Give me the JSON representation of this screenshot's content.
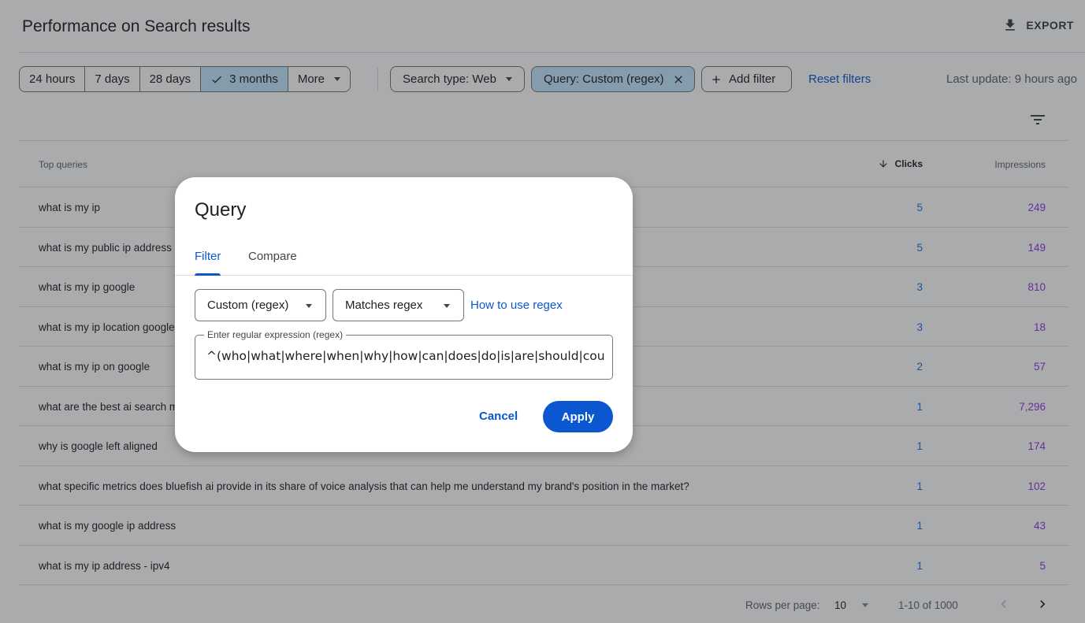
{
  "header": {
    "title": "Performance on Search results",
    "export_label": "EXPORT"
  },
  "date_range": {
    "options": [
      "24 hours",
      "7 days",
      "28 days",
      "3 months",
      "More"
    ],
    "selected": "3 months"
  },
  "filters": {
    "search_type": "Search type: Web",
    "query_chip": "Query: Custom (regex)",
    "add_filter": "Add filter",
    "reset": "Reset filters",
    "last_update": "Last update: 9 hours ago"
  },
  "table": {
    "col_query": "Top queries",
    "col_clicks": "Clicks",
    "col_impressions": "Impressions",
    "rows": [
      {
        "query": "what is my ip",
        "clicks": "5",
        "impressions": "249"
      },
      {
        "query": "what is my public ip address",
        "clicks": "5",
        "impressions": "149"
      },
      {
        "query": "what is my ip google",
        "clicks": "3",
        "impressions": "810"
      },
      {
        "query": "what is my ip location google",
        "clicks": "3",
        "impressions": "18"
      },
      {
        "query": "what is my ip on google",
        "clicks": "2",
        "impressions": "57"
      },
      {
        "query": "what are the best ai search m",
        "clicks": "1",
        "impressions": "7,296"
      },
      {
        "query": "why is google left aligned",
        "clicks": "1",
        "impressions": "174"
      },
      {
        "query": "what specific metrics does bluefish ai provide in its share of voice analysis that can help me understand my brand's position in the market?",
        "clicks": "1",
        "impressions": "102"
      },
      {
        "query": "what is my google ip address",
        "clicks": "1",
        "impressions": "43"
      },
      {
        "query": "what is my ip address - ipv4",
        "clicks": "1",
        "impressions": "5"
      }
    ]
  },
  "pagination": {
    "rows_per_page_label": "Rows per page:",
    "rows_per_page_value": "10",
    "range": "1-10 of 1000"
  },
  "dialog": {
    "title": "Query",
    "tabs": [
      "Filter",
      "Compare"
    ],
    "active_tab": "Filter",
    "type_select": "Custom (regex)",
    "match_select": "Matches regex",
    "help_link": "How to use regex",
    "field_label": "Enter regular expression (regex)",
    "field_value": "^(who|what|where|when|why|how|can|does|do|is|are|should|could",
    "cancel": "Cancel",
    "apply": "Apply"
  },
  "colors": {
    "accent": "#0b57d0",
    "selected_chip": "#c2e7ff",
    "clicks": "#1a73e8",
    "impressions": "#9334e6"
  }
}
